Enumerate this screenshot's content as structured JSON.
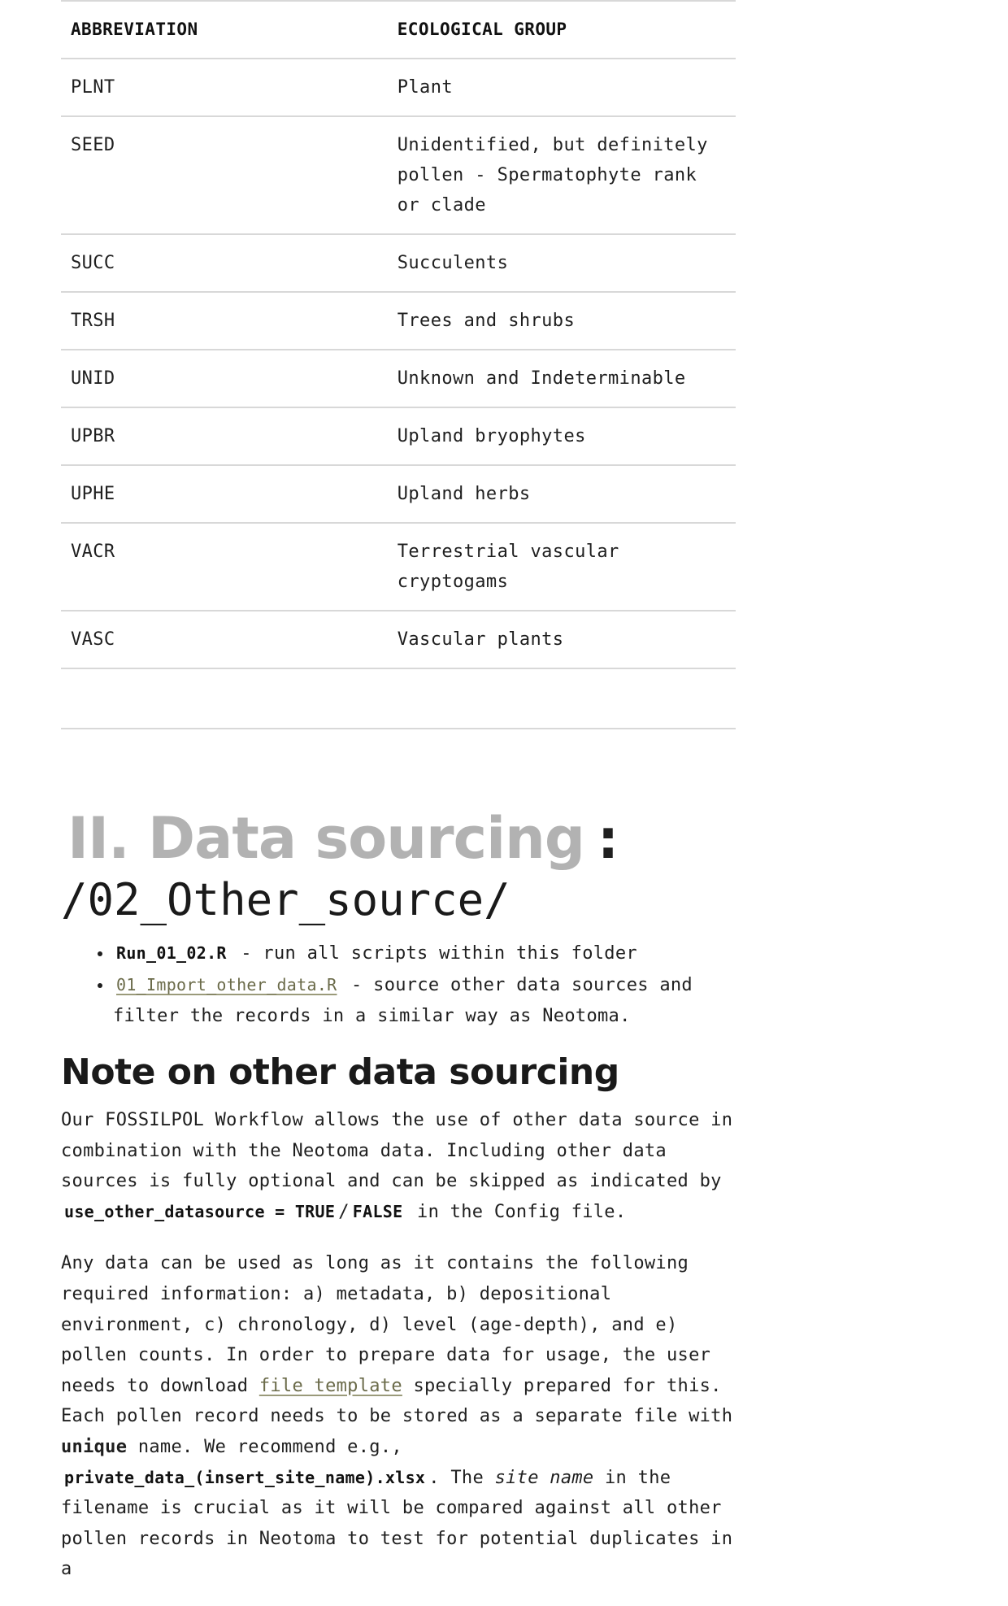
{
  "table": {
    "headers": [
      "ABBREVIATION",
      "ECOLOGICAL GROUP"
    ],
    "rows": [
      {
        "abbr": "PLNT",
        "group": "Plant"
      },
      {
        "abbr": "SEED",
        "group": "Unidentified, but definitely pollen - Spermatophyte rank or clade"
      },
      {
        "abbr": "SUCC",
        "group": "Succulents"
      },
      {
        "abbr": "TRSH",
        "group": "Trees and shrubs"
      },
      {
        "abbr": "UNID",
        "group": "Unknown and Indeterminable"
      },
      {
        "abbr": "UPBR",
        "group": "Upland bryophytes"
      },
      {
        "abbr": "UPHE",
        "group": "Upland herbs"
      },
      {
        "abbr": "VACR",
        "group": "Terrestrial vascular cryptogams"
      },
      {
        "abbr": "VASC",
        "group": "Vascular plants"
      }
    ]
  },
  "section": {
    "title_grey": "II. Data sourcing",
    "title_colon": ":",
    "folder": "/02_Other_source/"
  },
  "scripts": [
    {
      "file": "Run_01_02.R",
      "desc": " - run all scripts within this folder"
    },
    {
      "file": "01_Import_other_data.R",
      "desc": " - source other data sources and filter the records in a similar way as Neotoma."
    }
  ],
  "note": {
    "heading": "Note on other data sourcing",
    "p1_a": "Our FOSSILPOL Workflow allows the use of other data source in combination with the Neotoma data. Including other data sources is fully optional and can be skipped as indicated by ",
    "p1_code1": "use_other_datasource = TRUE",
    "p1_slash": "/",
    "p1_code2": "FALSE",
    "p1_b": " in the Config file.",
    "p2_a": "Any data can be used as long as it contains the following required information: a) metadata, b) depositional environment, c) chronology, d) level (age-depth), and e) pollen counts. In order to prepare data for usage, the user needs to download ",
    "p2_link": "file template",
    "p2_b": " specially prepared for this. Each pollen record needs to be stored as a separate file with ",
    "p2_strong": "unique",
    "p2_c": " name. We recommend e.g., ",
    "p2_code": "private_data_(insert_site_name).xlsx",
    "p2_d": ". The ",
    "p2_em": "site name",
    "p2_e": " in the filename is crucial as it will be compared against all other pollen records in Neotoma to test for potential duplicates in a"
  }
}
